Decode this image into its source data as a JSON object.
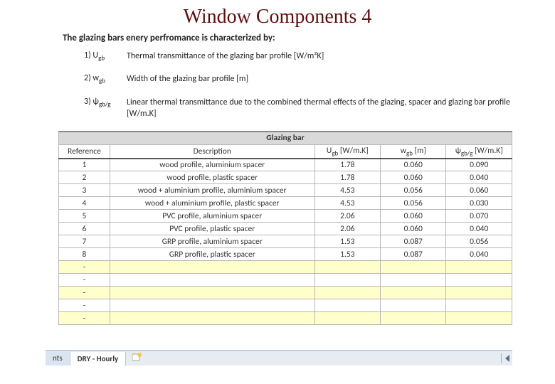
{
  "title": "Window Components 4",
  "intro": "The glazing bars enery perfromance is characterized by:",
  "params": [
    {
      "idx": "1) U",
      "idx_sub": "gb",
      "text": "Thermal transmittance of the glazing bar profile [W/m²K]"
    },
    {
      "idx": "2) w",
      "idx_sub": "gb",
      "text": "Width of the glazing bar profile [m]"
    },
    {
      "idx": "3) ψ",
      "idx_sub": "gb/g",
      "text": "Linear thermal transmittance due to the combined thermal effects of the glazing, spacer and glazing bar profile [W/m.K]"
    }
  ],
  "table": {
    "banner": "Glazing bar",
    "headers": {
      "ref": "Reference",
      "desc": "Description",
      "u": "U",
      "u_sub": "gb",
      "u_unit": " [W/m.K]",
      "w": "w",
      "w_sub": "gb",
      "w_unit": " [m]",
      "psi": "ψ",
      "psi_sub": "gb/g",
      "psi_unit": " [W/m.K]"
    },
    "rows": [
      {
        "ref": "1",
        "desc": "wood profile, aluminium spacer",
        "u": "1.78",
        "w": "0.060",
        "psi": "0.090"
      },
      {
        "ref": "2",
        "desc": "wood profile, plastic spacer",
        "u": "1.78",
        "w": "0.060",
        "psi": "0.040"
      },
      {
        "ref": "3",
        "desc": "wood + aluminium profile, aluminium spacer",
        "u": "4.53",
        "w": "0.056",
        "psi": "0.060"
      },
      {
        "ref": "4",
        "desc": "wood + aluminium profile, plastic spacer",
        "u": "4.53",
        "w": "0.056",
        "psi": "0.030"
      },
      {
        "ref": "5",
        "desc": "PVC profile, aluminium spacer",
        "u": "2.06",
        "w": "0.060",
        "psi": "0.070"
      },
      {
        "ref": "6",
        "desc": "PVC profile, plastic spacer",
        "u": "2.06",
        "w": "0.060",
        "psi": "0.040"
      },
      {
        "ref": "7",
        "desc": "GRP profile, aluminium spacer",
        "u": "1.53",
        "w": "0.087",
        "psi": "0.056"
      },
      {
        "ref": "8",
        "desc": "GRP profile, plastic spacer",
        "u": "1.53",
        "w": "0.087",
        "psi": "0.040"
      }
    ],
    "empty_rows": [
      {
        "ref": "-",
        "yellow": true
      },
      {
        "ref": "-",
        "yellow": false
      },
      {
        "ref": "-",
        "yellow": true
      },
      {
        "ref": "-",
        "yellow": false
      },
      {
        "ref": "-",
        "yellow": true
      }
    ]
  },
  "sheets": {
    "partial": "nts",
    "active": "DRY - Hourly"
  }
}
